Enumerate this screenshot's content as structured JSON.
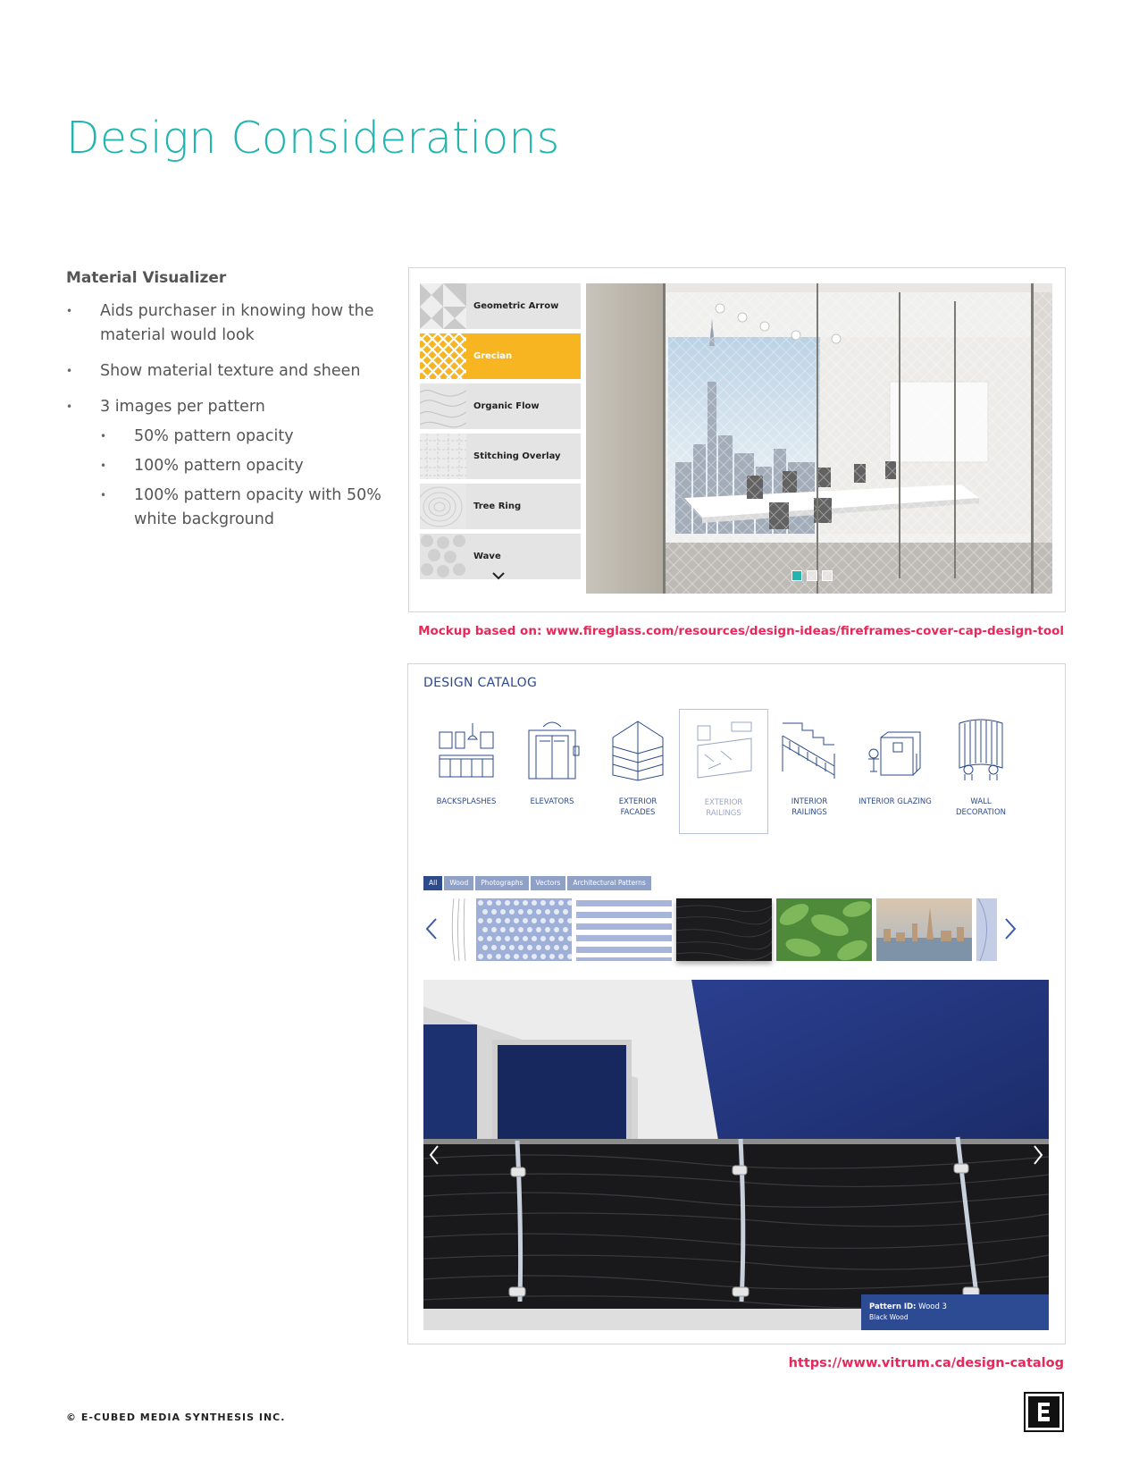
{
  "page": {
    "title": "Design Considerations",
    "section_heading": "Material Visualizer",
    "bullets": [
      "Aids purchaser in knowing how the material would look",
      "Show material texture and sheen",
      "3 images per pattern"
    ],
    "sub_bullets": [
      "50% pattern opacity",
      "100% pattern opacity",
      "100% pattern opacity with 50% white background"
    ],
    "footer_copyright": "© E-CUBED MEDIA SYNTHESIS INC."
  },
  "visualizer": {
    "patterns": [
      "Geometric Arrow",
      "Grecian",
      "Organic Flow",
      "Stitching Overlay",
      "Tree Ring",
      "Wave"
    ],
    "active_pattern": "Grecian",
    "caption": "Mockup based on: www.fireglass.com/resources/design-ideas/fireframes-cover-cap-design-tool",
    "colors": {
      "accent": "#f6b521",
      "teal": "#22b5b0"
    }
  },
  "catalog": {
    "title": "DESIGN CATALOG",
    "categories": [
      {
        "line1": "BACKSPLASHES",
        "line2": ""
      },
      {
        "line1": "ELEVATORS",
        "line2": ""
      },
      {
        "line1": "EXTERIOR",
        "line2": "FACADES"
      },
      {
        "line1": "EXTERIOR",
        "line2": "RAILINGS"
      },
      {
        "line1": "INTERIOR",
        "line2": "RAILINGS"
      },
      {
        "line1": "INTERIOR GLAZING",
        "line2": ""
      },
      {
        "line1": "WALL",
        "line2": "DECORATION"
      }
    ],
    "selected_category": "EXTERIOR RAILINGS",
    "filters": [
      "All",
      "Wood",
      "Photographs",
      "Vectors",
      "Architectural Patterns"
    ],
    "active_filter": "All",
    "pattern_id_label": "Pattern ID:",
    "pattern_id_value": "Wood 3",
    "pattern_name": "Black Wood",
    "caption": "https://www.vitrum.ca/design-catalog",
    "colors": {
      "primary": "#2c4a8c",
      "chip": "#8fa1c7",
      "caption": "#e8275a"
    }
  }
}
